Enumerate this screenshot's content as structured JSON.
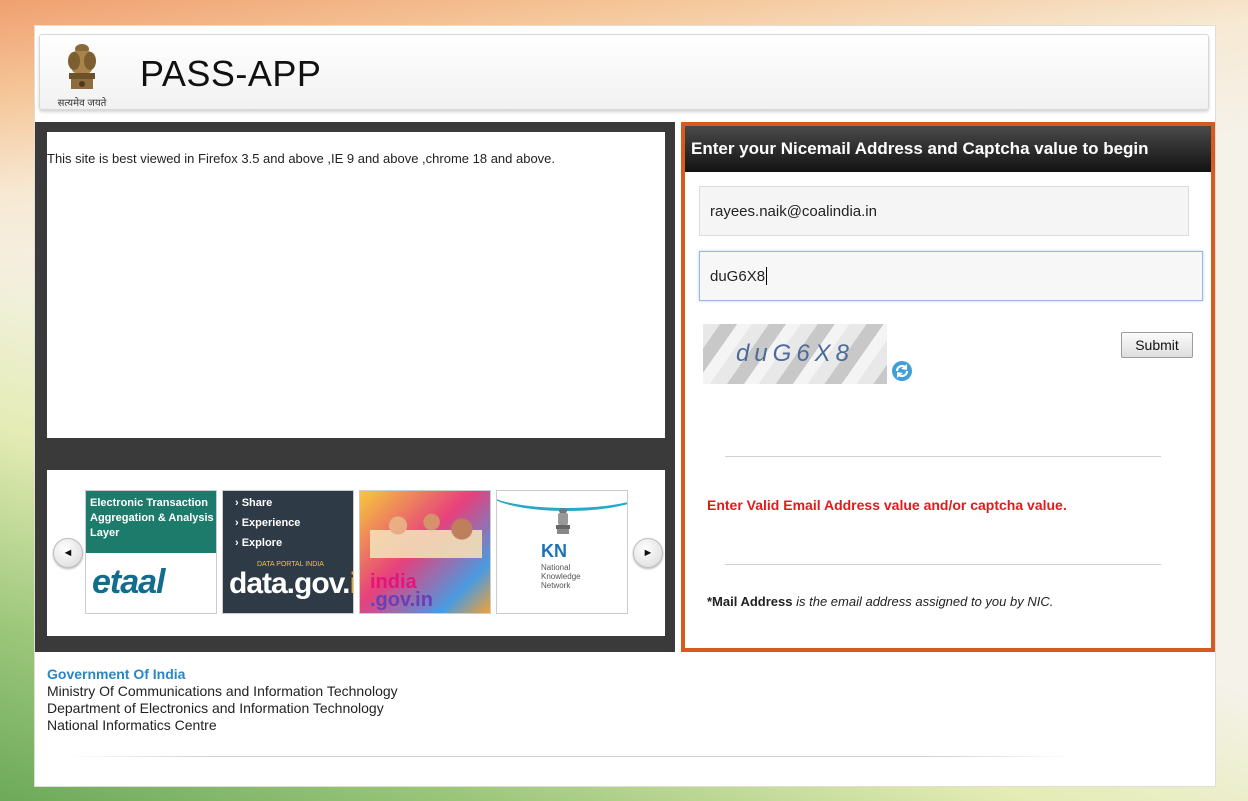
{
  "header": {
    "app_title": "PASS-APP",
    "emblem_caption": "सत्यमेव जयते"
  },
  "notice": {
    "text": "This site is best viewed in Firefox 3.5 and above ,IE 9 and above ,chrome 18 and above."
  },
  "carousel": {
    "prev_icon": "◄",
    "next_icon": "►",
    "etaal": {
      "lines": [
        "Electronic Transaction",
        "Aggregation & Analysis",
        "Layer"
      ],
      "logo": "etaal"
    },
    "datagov": {
      "menu": [
        "› Share",
        "› Experience",
        "› Explore"
      ],
      "subtitle": "DATA PORTAL INDIA",
      "logo_main": "data.gov.",
      "logo_accent": "in"
    },
    "indiagov": {
      "logo_line1": "india",
      "logo_line2": ".gov.in"
    },
    "nkn": {
      "logo": "KN",
      "text_lines": [
        "National",
        "Knowledge",
        "Network"
      ]
    }
  },
  "login": {
    "heading": "Enter your Nicemail Address and Captcha value to begin",
    "email_value": "rayees.naik@coalindia.in",
    "captcha_value": "duG6X8",
    "captcha_image_text": "duG6X8",
    "submit_label": "Submit",
    "error_message": "Enter Valid Email Address value and/or captcha value.",
    "note_bold": "*Mail Address",
    "note_rest": " is the email address assigned to you by NIC."
  },
  "footer": {
    "lines": [
      "Government Of India",
      "Ministry Of Communications and Information Technology",
      "Department of Electronics and Information Technology",
      "National Informatics Centre"
    ]
  },
  "colors": {
    "accent_border": "#d75a1f",
    "error_text": "#e11b1b",
    "footer_link": "#2a86c5"
  }
}
